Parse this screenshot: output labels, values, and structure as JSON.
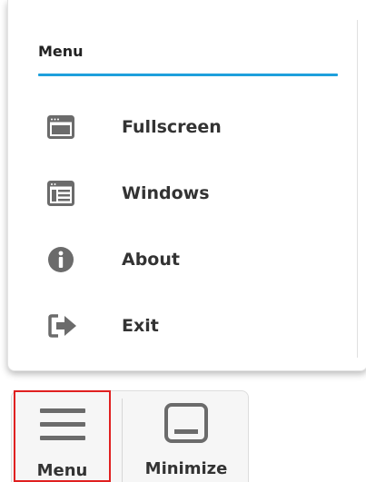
{
  "menu": {
    "title": "Menu",
    "items": [
      {
        "label": "Fullscreen",
        "icon": "fullscreen-window-icon"
      },
      {
        "label": "Windows",
        "icon": "window-list-icon"
      },
      {
        "label": "About",
        "icon": "info-circle-icon"
      },
      {
        "label": "Exit",
        "icon": "exit-arrow-icon"
      }
    ]
  },
  "toolbar": {
    "menu_label": "Menu",
    "minimize_label": "Minimize"
  },
  "colors": {
    "accent": "#1ea0dc",
    "active_outline": "#e02020",
    "icon": "#6b6b6b"
  }
}
